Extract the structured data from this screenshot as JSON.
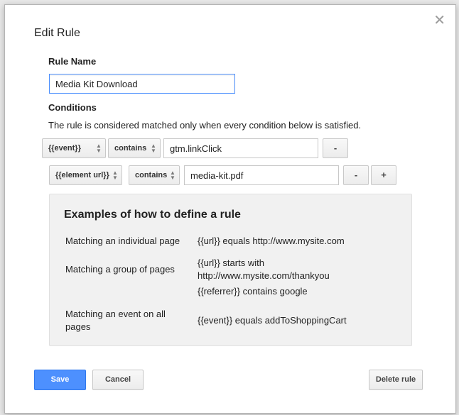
{
  "dialog": {
    "title": "Edit Rule",
    "close_icon": "close-icon"
  },
  "rule_name": {
    "label": "Rule Name",
    "value": "Media Kit Download"
  },
  "conditions": {
    "label": "Conditions",
    "description": "The rule is considered matched only when every condition below is satisfied.",
    "rows": [
      {
        "variable": "{{event}}",
        "operator": "contains",
        "value": "gtm.linkClick",
        "remove_label": "-"
      },
      {
        "variable": "{{element url}}",
        "operator": "contains",
        "value": "media-kit.pdf",
        "remove_label": "-",
        "add_label": "+"
      }
    ]
  },
  "examples": {
    "title": "Examples of how to define a rule",
    "items": [
      {
        "label": "Matching an individual page",
        "values": [
          "{{url}} equals http://www.mysite.com"
        ]
      },
      {
        "label": "Matching a group of pages",
        "values": [
          "{{url}} starts with http://www.mysite.com/thankyou",
          "{{referrer}} contains google"
        ]
      },
      {
        "label": "Matching an event on all pages",
        "values": [
          "{{event}} equals addToShoppingCart"
        ]
      }
    ]
  },
  "footer": {
    "save_label": "Save",
    "cancel_label": "Cancel",
    "delete_label": "Delete rule"
  },
  "colors": {
    "primary_button": "#4d90fe",
    "focus_border": "#4d90fe"
  }
}
